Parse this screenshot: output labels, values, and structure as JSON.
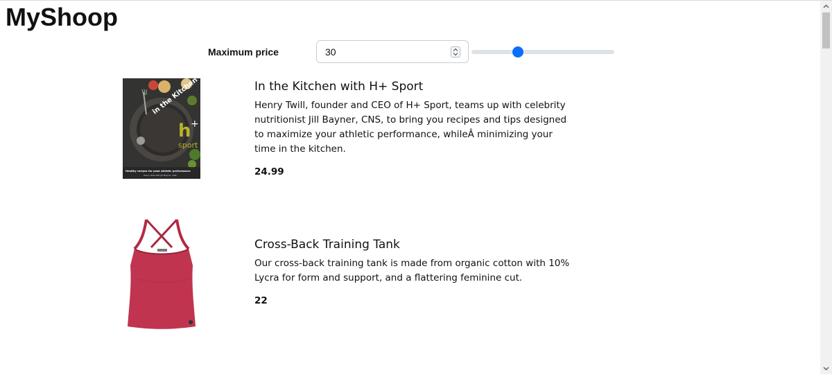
{
  "header": {
    "brand": "MyShoop"
  },
  "filter": {
    "label": "Maximum price",
    "input_value": "30",
    "slider_level": 0.31
  },
  "products": [
    {
      "name": "In the Kitchen with H+ Sport",
      "description": "Henry Twill, founder and CEO of H+ Sport, teams up with celebrity nutritionist Jill Bayner, CNS, to bring you recipes and tips designed to maximize your athletic performance, whileÂ minimizing your time in the kitchen.",
      "price": "24.99",
      "image": {
        "cover_title": "in the Kitchen with",
        "logo_mark": "h",
        "logo_plus": "+",
        "logo_word": "sport",
        "tagline": "Healthy recipes for peak athletic performance",
        "byline": "Henry Twill with Jill Bayner, CNS"
      }
    },
    {
      "name": "Cross-Back Training Tank",
      "description": "Our cross-back training tank is made from organic cotton with 10% Lycra for form and support, and a flattering feminine cut.",
      "price": "22",
      "image": {
        "icon": "tank-top-image",
        "color": "#c0344f"
      }
    }
  ],
  "colors": {
    "accent": "#0d6efd",
    "track": "#dee2e6"
  }
}
